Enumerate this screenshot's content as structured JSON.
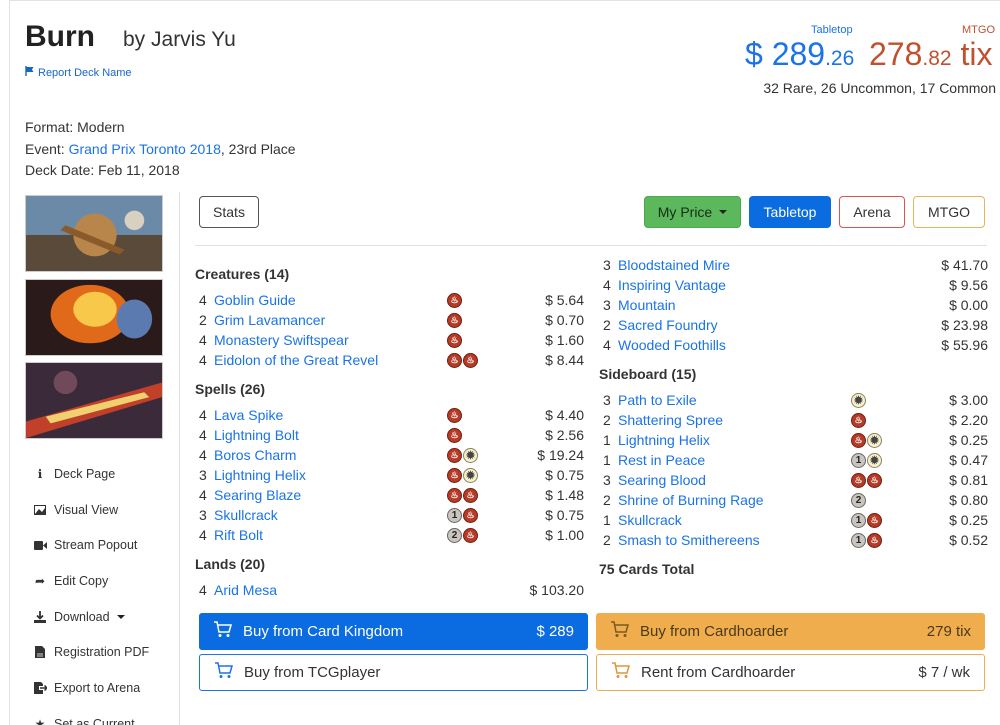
{
  "header": {
    "deck_name": "Burn",
    "author": "by Jarvis Yu",
    "report_label": "Report Deck Name",
    "tabletop_label": "Tabletop",
    "mtgo_label": "MTGO",
    "tabletop_price_main": "$ 289",
    "tabletop_price_dec": ".26",
    "mtgo_price_main": "278",
    "mtgo_price_dec": ".82",
    "mtgo_unit": " tix",
    "rarity": "32 Rare, 26 Uncommon, 17 Common"
  },
  "meta": {
    "format_label": "Format: ",
    "format": "Modern",
    "event_label": "Event: ",
    "event": "Grand Prix Toronto 2018",
    "event_place": ", 23rd Place",
    "date_label": "Deck Date: ",
    "date": "Feb 11, 2018"
  },
  "sidebar": {
    "items": [
      {
        "label": "Deck Page",
        "icon": "info-icon"
      },
      {
        "label": "Visual View",
        "icon": "image-icon"
      },
      {
        "label": "Stream Popout",
        "icon": "video-icon"
      },
      {
        "label": "Edit Copy",
        "icon": "share-icon"
      },
      {
        "label": "Download",
        "icon": "download-icon"
      },
      {
        "label": "Registration PDF",
        "icon": "pdf-icon"
      },
      {
        "label": "Export to Arena",
        "icon": "export-icon"
      },
      {
        "label": "Set as Current",
        "icon": "star-icon"
      }
    ]
  },
  "toolbar": {
    "stats": "Stats",
    "my_price": "My Price",
    "tabletop": "Tabletop",
    "arena": "Arena",
    "mtgo": "MTGO"
  },
  "sections": {
    "creatures": "Creatures (14)",
    "spells": "Spells (26)",
    "lands": "Lands (20)",
    "sideboard": "Sideboard (15)"
  },
  "creatures": [
    {
      "qty": "4",
      "name": "Goblin Guide",
      "price": "$ 5.64"
    },
    {
      "qty": "2",
      "name": "Grim Lavamancer",
      "price": "$ 0.70"
    },
    {
      "qty": "4",
      "name": "Monastery Swiftspear",
      "price": "$ 1.60"
    },
    {
      "qty": "4",
      "name": "Eidolon of the Great Revel",
      "price": "$ 8.44"
    }
  ],
  "spells": [
    {
      "qty": "4",
      "name": "Lava Spike",
      "price": "$ 4.40"
    },
    {
      "qty": "4",
      "name": "Lightning Bolt",
      "price": "$ 2.56"
    },
    {
      "qty": "4",
      "name": "Boros Charm",
      "price": "$ 19.24"
    },
    {
      "qty": "3",
      "name": "Lightning Helix",
      "price": "$ 0.75"
    },
    {
      "qty": "4",
      "name": "Searing Blaze",
      "price": "$ 1.48"
    },
    {
      "qty": "3",
      "name": "Skullcrack",
      "price": "$ 0.75"
    },
    {
      "qty": "4",
      "name": "Rift Bolt",
      "price": "$ 1.00"
    }
  ],
  "lands": [
    {
      "qty": "4",
      "name": "Arid Mesa",
      "price": "$ 103.20"
    }
  ],
  "lands_cont": [
    {
      "qty": "3",
      "name": "Bloodstained Mire",
      "price": "$ 41.70"
    },
    {
      "qty": "4",
      "name": "Inspiring Vantage",
      "price": "$ 9.56"
    },
    {
      "qty": "3",
      "name": "Mountain",
      "price": "$ 0.00"
    },
    {
      "qty": "2",
      "name": "Sacred Foundry",
      "price": "$ 23.98"
    },
    {
      "qty": "4",
      "name": "Wooded Foothills",
      "price": "$ 55.96"
    }
  ],
  "sideboard": [
    {
      "qty": "3",
      "name": "Path to Exile",
      "price": "$ 3.00"
    },
    {
      "qty": "2",
      "name": "Shattering Spree",
      "price": "$ 2.20"
    },
    {
      "qty": "1",
      "name": "Lightning Helix",
      "price": "$ 0.25"
    },
    {
      "qty": "1",
      "name": "Rest in Peace",
      "price": "$ 0.47"
    },
    {
      "qty": "3",
      "name": "Searing Blood",
      "price": "$ 0.81"
    },
    {
      "qty": "2",
      "name": "Shrine of Burning Rage",
      "price": "$ 0.80"
    },
    {
      "qty": "1",
      "name": "Skullcrack",
      "price": "$ 0.25"
    },
    {
      "qty": "2",
      "name": "Smash to Smithereens",
      "price": "$ 0.52"
    }
  ],
  "total": "75 Cards Total",
  "buy": {
    "ck_label": "Buy from Card Kingdom",
    "ck_price": "$ 289",
    "ch_label": "Buy from Cardhoarder",
    "ch_price": "279 tix",
    "tcg_label": "Buy from TCGplayer",
    "rent_label": "Rent from Cardhoarder",
    "rent_price": "$ 7 / wk"
  },
  "mana_pips": {
    "1": "1",
    "2": "2"
  },
  "colors": {
    "link": "#1a73e8",
    "mtgo": "#c0512f",
    "tabletop_btn": "#0b6be0",
    "my_price_btn": "#5cb85c",
    "cardhoarder": "#f0ad4e"
  }
}
